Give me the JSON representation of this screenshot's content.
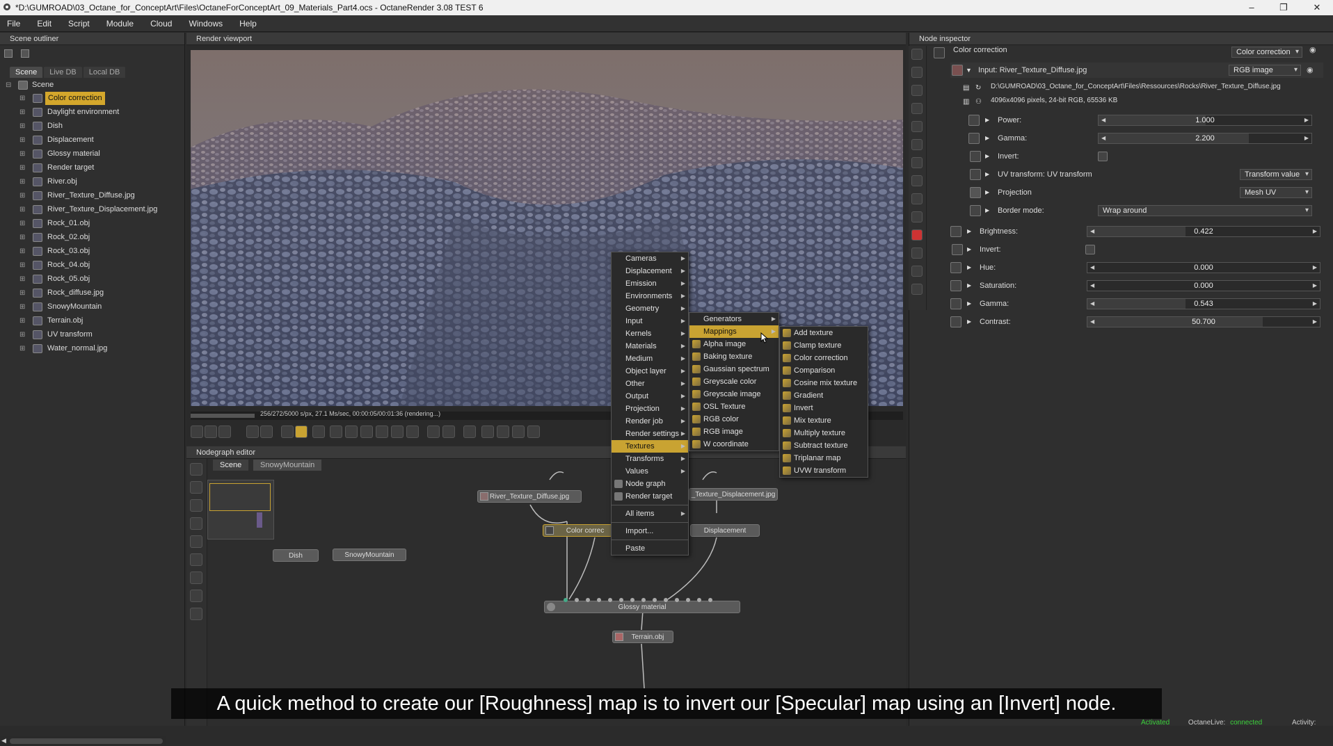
{
  "window": {
    "title": "*D:\\GUMROAD\\03_Octane_for_ConceptArt\\Files\\OctaneForConceptArt_09_Materials_Part4.ocs - OctaneRender 3.08 TEST 6",
    "controls": [
      "–",
      "❐",
      "✕"
    ]
  },
  "menubar": [
    "File",
    "Edit",
    "Script",
    "Module",
    "Cloud",
    "Windows",
    "Help"
  ],
  "outliner": {
    "title": "Scene outliner",
    "tabs": [
      "Scene",
      "Live DB",
      "Local DB"
    ],
    "root": "Scene",
    "items": [
      {
        "label": "Color correction",
        "icon": "color-correction-icon",
        "selected": true
      },
      {
        "label": "Daylight environment",
        "icon": "environment-icon"
      },
      {
        "label": "Dish",
        "icon": "mesh-icon"
      },
      {
        "label": "Displacement",
        "icon": "displacement-icon"
      },
      {
        "label": "Glossy material",
        "icon": "material-icon"
      },
      {
        "label": "Render target",
        "icon": "render-target-icon"
      },
      {
        "label": "River.obj",
        "icon": "mesh-icon"
      },
      {
        "label": "River_Texture_Diffuse.jpg",
        "icon": "texture-icon"
      },
      {
        "label": "River_Texture_Displacement.jpg",
        "icon": "texture-icon"
      },
      {
        "label": "Rock_01.obj",
        "icon": "mesh-icon"
      },
      {
        "label": "Rock_02.obj",
        "icon": "mesh-icon"
      },
      {
        "label": "Rock_03.obj",
        "icon": "mesh-icon"
      },
      {
        "label": "Rock_04.obj",
        "icon": "mesh-icon"
      },
      {
        "label": "Rock_05.obj",
        "icon": "mesh-icon"
      },
      {
        "label": "Rock_diffuse.jpg",
        "icon": "texture-icon"
      },
      {
        "label": "SnowyMountain",
        "icon": "node-graph-icon"
      },
      {
        "label": "Terrain.obj",
        "icon": "mesh-icon"
      },
      {
        "label": "UV transform",
        "icon": "transform-icon"
      },
      {
        "label": "Water_normal.jpg",
        "icon": "texture-icon"
      }
    ]
  },
  "viewport": {
    "title": "Render viewport",
    "status": "256/272/5000 s/px, 27.1 Ms/sec, 00:00:05/00:01:36 (rendering...)",
    "progress": 0.09
  },
  "nodegraph": {
    "title": "Nodegraph editor",
    "tabs": [
      "Scene",
      "SnowyMountain"
    ],
    "nodes": {
      "river_diffuse": "River_Texture_Diffuse.jpg",
      "river_displacement": "_Texture_Displacement.jpg",
      "color_correction": "Color correc",
      "displacement": "Displacement",
      "dish": "Dish",
      "snowy": "SnowyMountain",
      "glossy": "Glossy material",
      "terrain": "Terrain.obj"
    }
  },
  "context_menu": {
    "main": [
      "Cameras",
      "Displacement",
      "Emission",
      "Environments",
      "Geometry",
      "Input",
      "Kernels",
      "Materials",
      "Medium",
      "Object layer",
      "Other",
      "Output",
      "Projection",
      "Render job",
      "Render settings",
      "Textures",
      "Transforms",
      "Values"
    ],
    "main_extra": [
      "Node graph",
      "Render target"
    ],
    "all_items": "All items",
    "import": "Import...",
    "paste": "Paste",
    "textures_sub": [
      "Generators",
      "Mappings",
      "Alpha image",
      "Baking texture",
      "Gaussian spectrum",
      "Greyscale color",
      "Greyscale image",
      "OSL Texture",
      "RGB color",
      "RGB image",
      "W coordinate"
    ],
    "mappings_sub": [
      "Add texture",
      "Clamp texture",
      "Color correction",
      "Comparison",
      "Cosine mix texture",
      "Gradient",
      "Invert",
      "Mix texture",
      "Multiply texture",
      "Subtract texture",
      "Triplanar map",
      "UVW transform"
    ]
  },
  "inspector": {
    "title": "Node inspector",
    "node_name": "Color correction",
    "node_type": "Color correction",
    "input_label": "Input: River_Texture_Diffuse.jpg",
    "input_type": "RGB image",
    "file_path": "D:\\GUMROAD\\03_Octane_for_ConceptArt\\Files\\Ressources\\Rocks\\River_Texture_Diffuse.jpg",
    "file_info": "4096x4096 pixels, 24-bit RGB, 65536 KB",
    "sub_params": [
      {
        "label": "Power:",
        "value": "1.000",
        "fill": 0.5
      },
      {
        "label": "Gamma:",
        "value": "2.200",
        "fill": 0.7
      }
    ],
    "invert_label": "Invert:",
    "uv_label": "UV transform: UV transform",
    "uv_value": "Transform value",
    "projection_label": "Projection",
    "projection_value": "Mesh UV",
    "border_label": "Border mode:",
    "border_value": "Wrap around",
    "params": [
      {
        "label": "Brightness:",
        "value": "0.422",
        "fill": 0.42
      },
      {
        "label": "Hue:",
        "value": "0.000",
        "fill": 0.0
      },
      {
        "label": "Saturation:",
        "value": "0.000",
        "fill": 0.0
      },
      {
        "label": "Gamma:",
        "value": "0.543",
        "fill": 0.42
      },
      {
        "label": "Contrast:",
        "value": "50.700",
        "fill": 0.75
      }
    ],
    "invert2_label": "Invert:"
  },
  "subtitle": "A quick method to create our [Roughness] map is to invert our [Specular] map using an [Invert] node.",
  "status_bar": {
    "activated": "Activated",
    "octanelive_label": "OctaneLive:",
    "octanelive_value": "connected",
    "activity_label": "Activity:"
  },
  "colors": {
    "accent": "#c9a332",
    "panel": "#2f2f2f",
    "connected": "#3cd23c"
  }
}
